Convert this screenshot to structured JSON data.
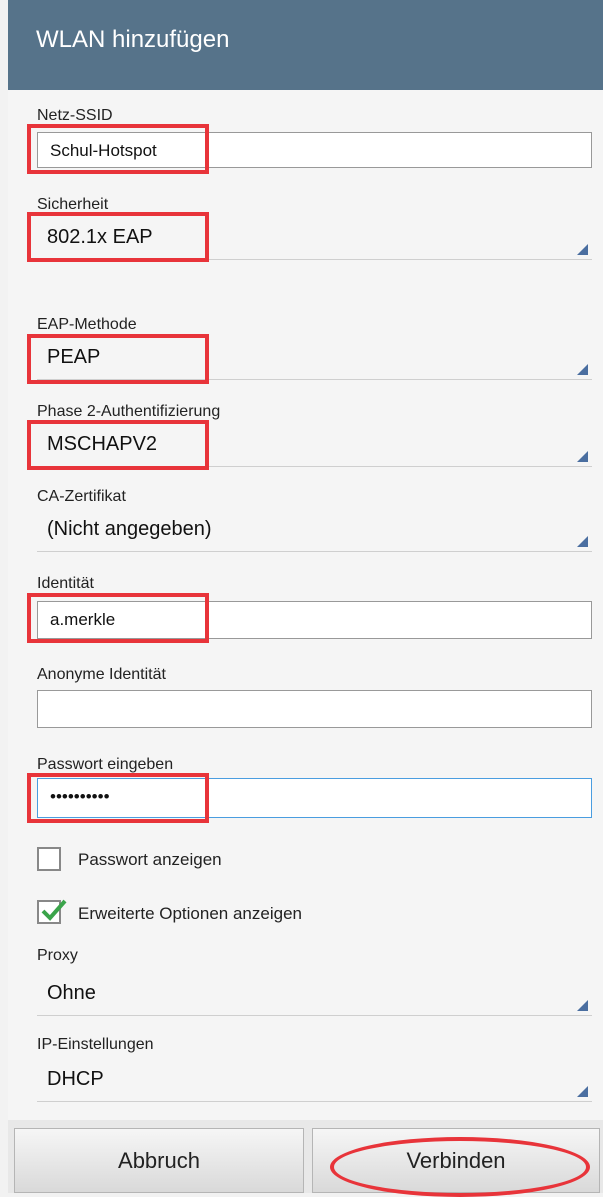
{
  "title": "WLAN hinzufügen",
  "fields": {
    "ssid": {
      "label": "Netz-SSID",
      "value": "Schul-Hotspot"
    },
    "security": {
      "label": "Sicherheit",
      "value": "802.1x EAP"
    },
    "eap_method": {
      "label": "EAP-Methode",
      "value": "PEAP"
    },
    "phase2": {
      "label": "Phase 2-Authentifizierung",
      "value": "MSCHAPV2"
    },
    "ca_cert": {
      "label": "CA-Zertifikat",
      "value": "(Nicht angegeben)"
    },
    "identity": {
      "label": "Identität",
      "value": "a.merkle"
    },
    "anon_identity": {
      "label": "Anonyme Identität",
      "value": ""
    },
    "password": {
      "label": "Passwort eingeben",
      "value": "••••••••••"
    },
    "proxy": {
      "label": "Proxy",
      "value": "Ohne"
    },
    "ip": {
      "label": "IP-Einstellungen",
      "value": "DHCP"
    }
  },
  "checkboxes": {
    "show_password": {
      "label": "Passwort anzeigen",
      "checked": false
    },
    "advanced": {
      "label": "Erweiterte Optionen anzeigen",
      "checked": true
    }
  },
  "buttons": {
    "cancel": "Abbruch",
    "connect": "Verbinden"
  },
  "colors": {
    "titlebar": "#56738a",
    "highlight": "#e8343a",
    "accent": "#4a9de0"
  }
}
